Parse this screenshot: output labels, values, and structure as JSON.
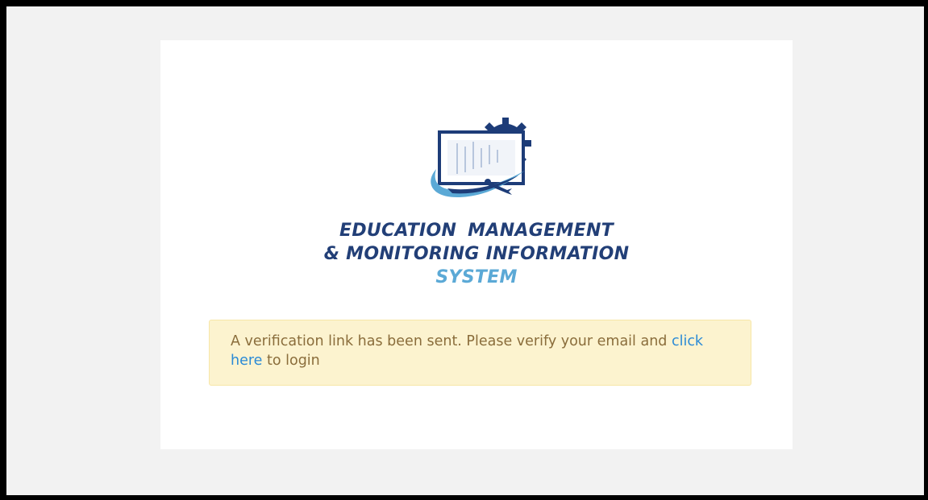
{
  "logo": {
    "line1": "EDUCATION  MANAGEMENT",
    "line2": "& MONITORING INFORMATION",
    "line3": "SYSTEM",
    "icon_name": "monitor-gear-logo-icon",
    "colors": {
      "navy": "#223f77",
      "light_blue": "#5ba9d6"
    }
  },
  "alert": {
    "message_before": "A verification link has been sent. Please verify your email and ",
    "link_text": "click here",
    "message_after": " to login",
    "background": "#fcf3cf",
    "text_color": "#8a6d3b",
    "link_color": "#2a8ad6"
  }
}
